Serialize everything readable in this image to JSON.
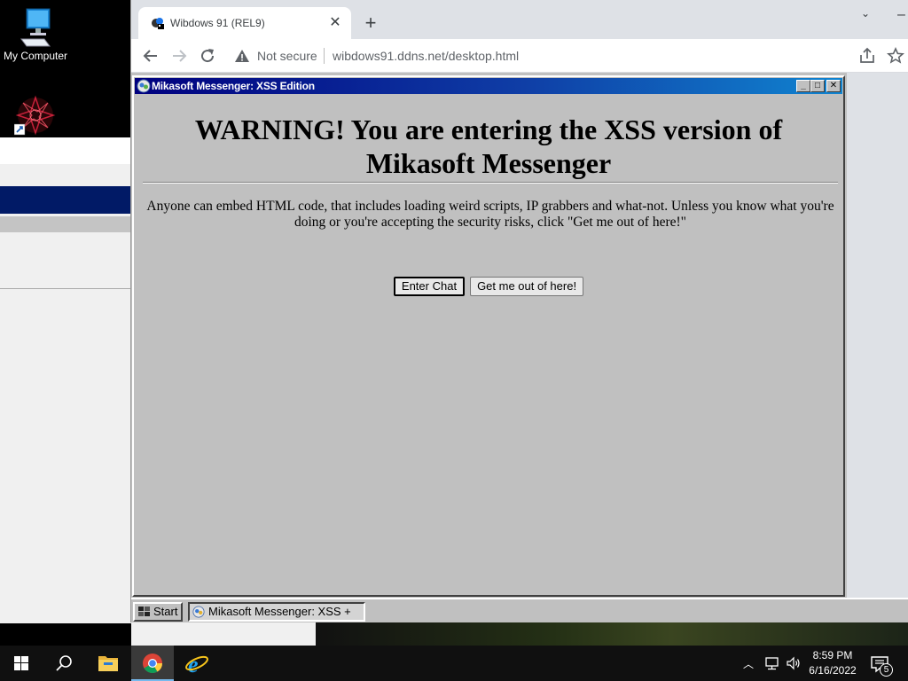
{
  "desktop": {
    "icons": [
      {
        "label": "My Computer",
        "icon": "computer-icon"
      },
      {
        "label": "",
        "icon": "app-shortcut-icon"
      }
    ]
  },
  "browser": {
    "tab": {
      "title": "Wibdows 91 (REL9)",
      "favicon": "wibdows-favicon"
    },
    "security_label": "Not secure",
    "url": "wibdows91.ddns.net/desktop.html"
  },
  "messenger": {
    "title": "Mikasoft Messenger: XSS Edition",
    "heading_line1": "WARNING! You are entering the XSS version of",
    "heading_line2": "Mikasoft Messenger",
    "warning_text": "Anyone can embed HTML code, that includes loading weird scripts, IP grabbers and what-not. Unless you know what you're doing or you're accepting the security risks, click \"Get me out of here!\"",
    "buttons": {
      "enter": "Enter Chat",
      "leave": "Get me out of here!"
    }
  },
  "wibdows_taskbar": {
    "start_label": "Start",
    "task_label": "Mikasoft Messenger: XSS +"
  },
  "windows_taskbar": {
    "pinned": [
      "start-icon",
      "search-icon",
      "file-explorer-icon",
      "chrome-icon",
      "internet-explorer-icon"
    ],
    "clock_time": "8:59 PM",
    "clock_date": "6/16/2022",
    "notification_count": "5"
  },
  "colors": {
    "title_bar_start": "#00007f",
    "title_bar_end": "#1084d0",
    "win9x_face": "#c0c0c0",
    "taskbar": "#101010"
  }
}
